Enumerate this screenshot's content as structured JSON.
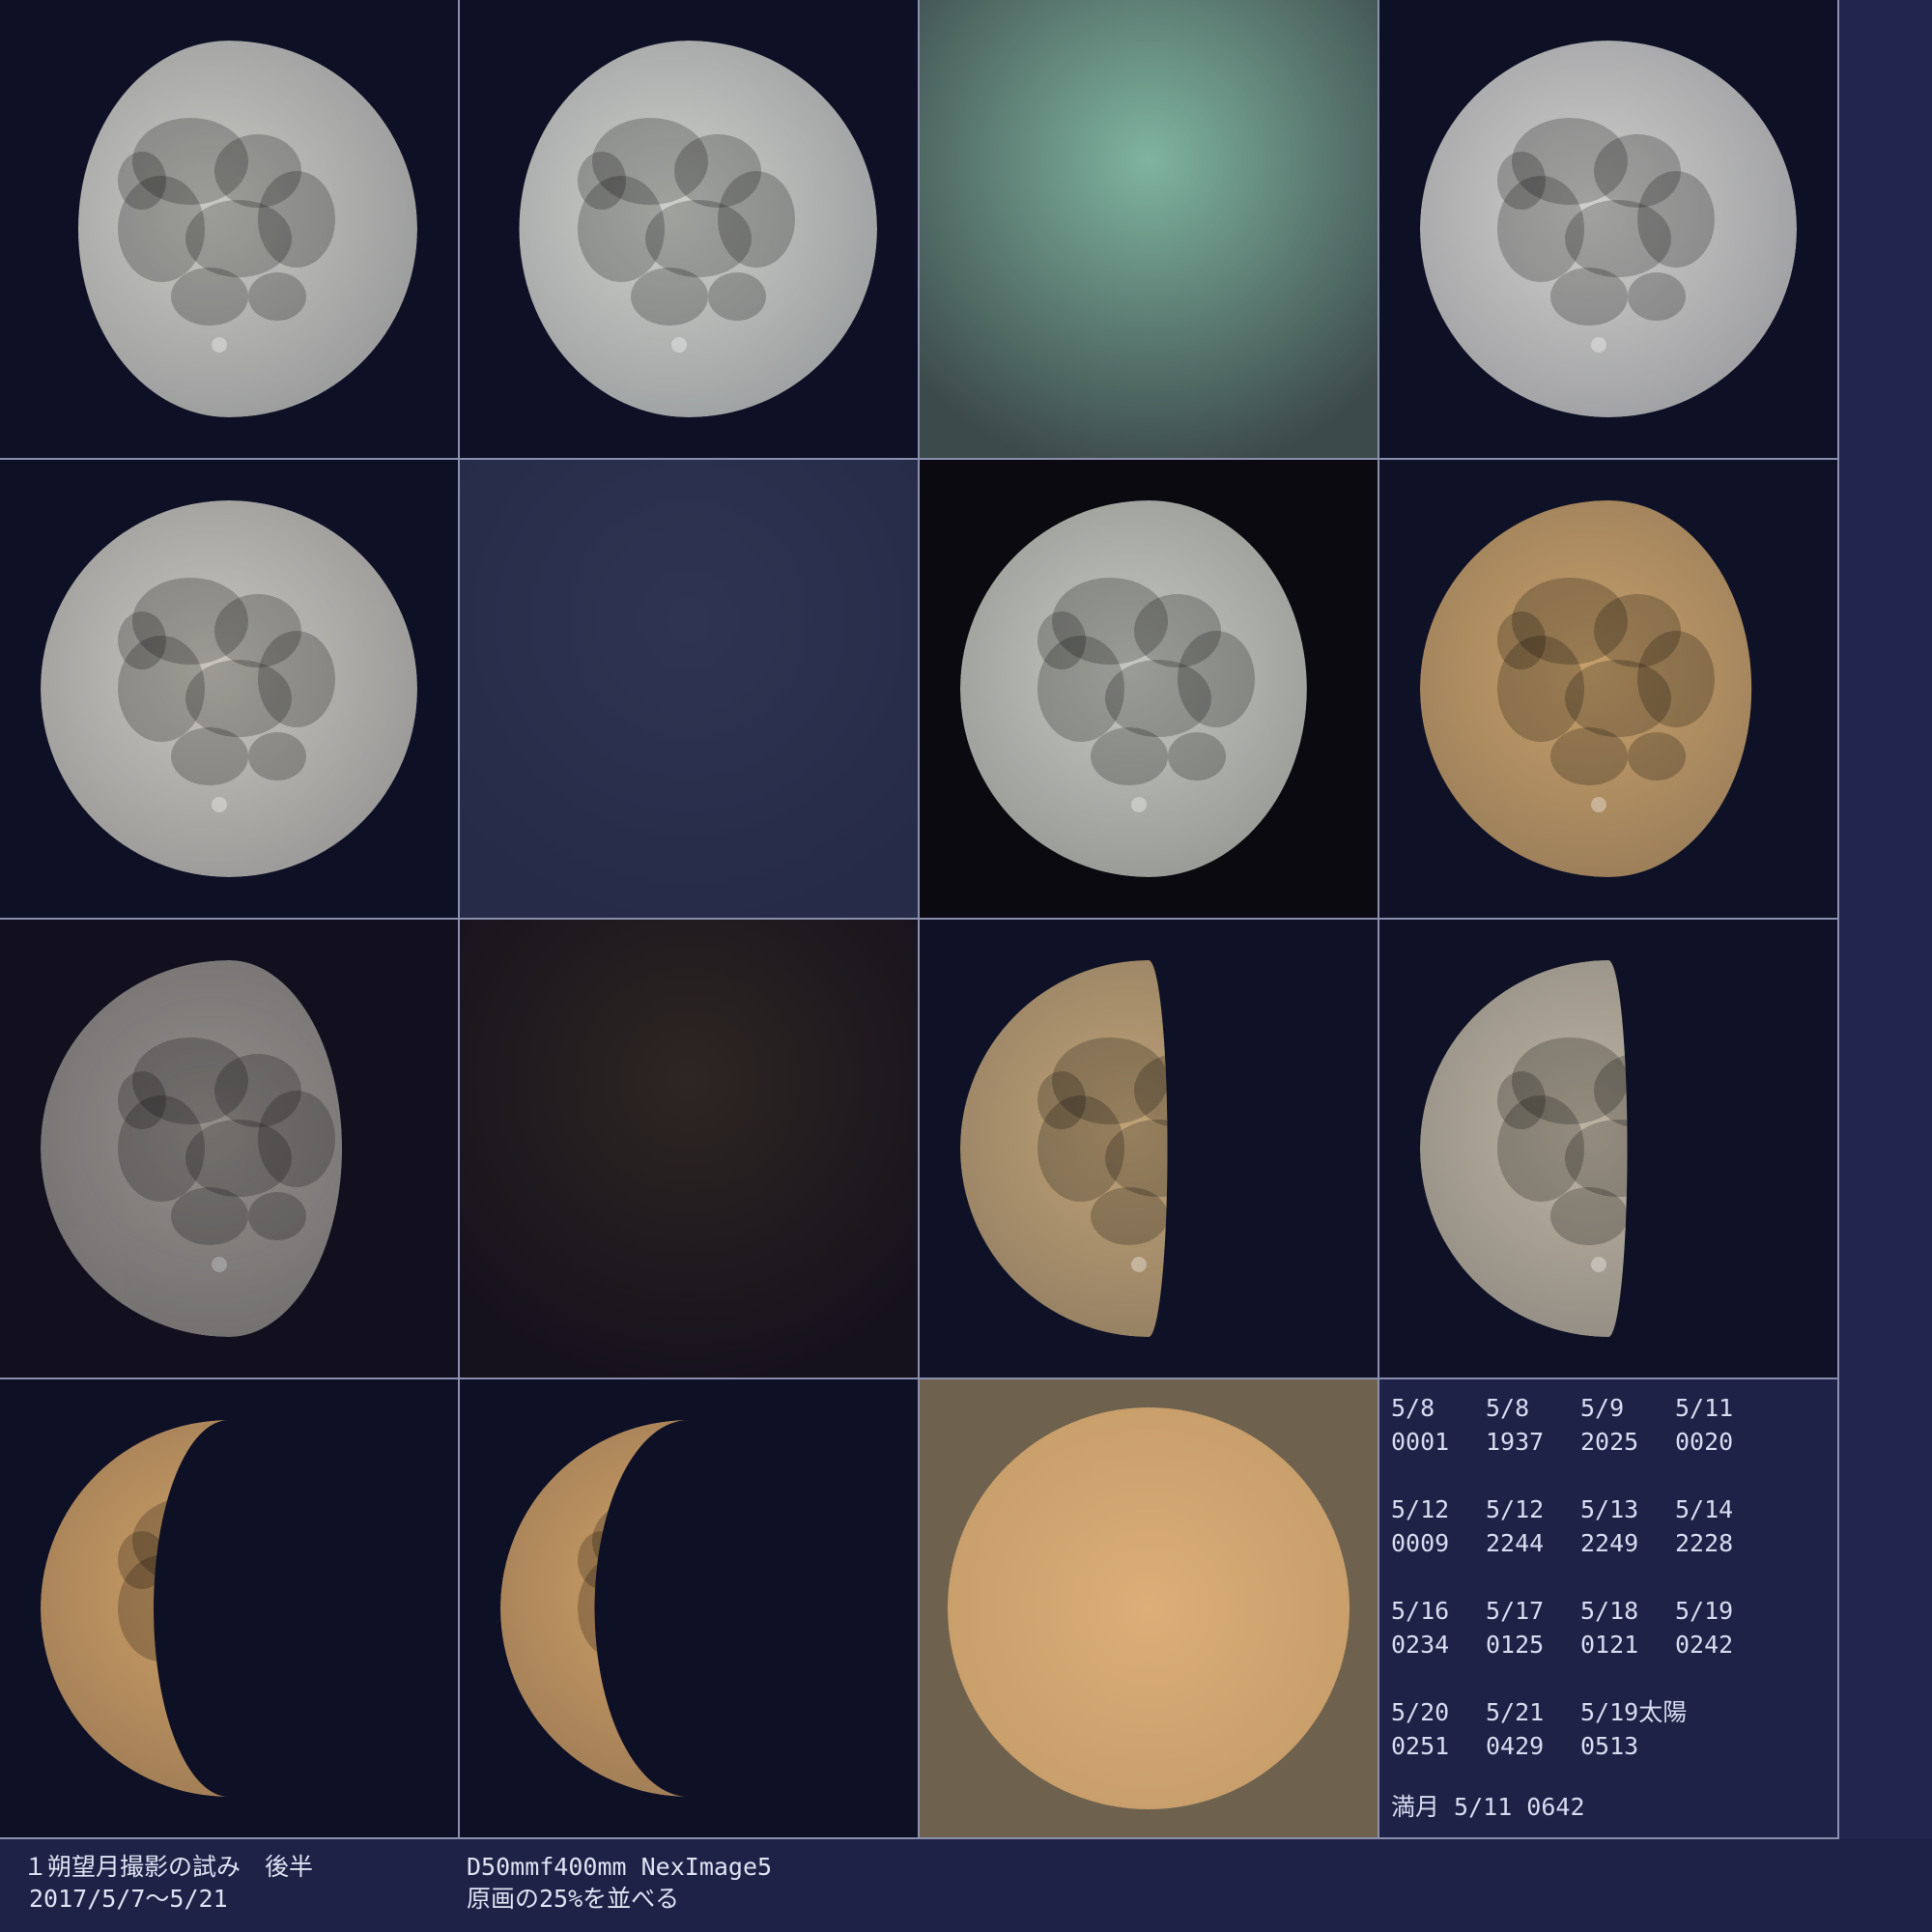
{
  "cells": [
    {
      "name": "moon-5-8-0001",
      "kind": "moon",
      "bg": "#0e1026",
      "tint": "#c9c9c3",
      "phase": 0.9,
      "dir": "right",
      "visible": 1.0
    },
    {
      "name": "moon-5-8-1937",
      "kind": "moon",
      "bg": "#0e1026",
      "tint": "#cdd0ca",
      "phase": 0.95,
      "dir": "right",
      "visible": 1.0
    },
    {
      "name": "sky-5-9-2025",
      "kind": "haze",
      "bg": "#3c4a4a",
      "tint": "#7fb4a0"
    },
    {
      "name": "moon-5-11-0020",
      "kind": "moon",
      "bg": "#0e1026",
      "tint": "#cfcfcc",
      "phase": 1.0,
      "dir": "right",
      "visible": 1.0
    },
    {
      "name": "moon-5-12-0009",
      "kind": "moon",
      "bg": "#0e1026",
      "tint": "#c8c6bd",
      "phase": 1.0,
      "dir": "left",
      "visible": 1.0
    },
    {
      "name": "sky-5-12-2244",
      "kind": "haze",
      "bg": "#262b47",
      "tint": "#2e3452"
    },
    {
      "name": "moon-5-13-2249",
      "kind": "moon",
      "bg": "#0b0a10",
      "tint": "#c5c8c0",
      "phase": 0.92,
      "dir": "left",
      "visible": 1.0
    },
    {
      "name": "moon-5-14-2228",
      "kind": "moon",
      "bg": "#0f1226",
      "tint": "#c7a06a",
      "phase": 0.88,
      "dir": "left",
      "visible": 1.0
    },
    {
      "name": "moon-5-16-0234",
      "kind": "moon",
      "bg": "#120f1e",
      "tint": "#a9a69e",
      "phase": 0.8,
      "dir": "left",
      "visible": 0.85
    },
    {
      "name": "sky-5-17-0125",
      "kind": "haze",
      "bg": "#15111d",
      "tint": "#2e2622"
    },
    {
      "name": "moon-5-18-0121",
      "kind": "moon",
      "bg": "#0f1226",
      "tint": "#c0a377",
      "phase": 0.55,
      "dir": "left",
      "visible": 1.0
    },
    {
      "name": "moon-5-19-0242",
      "kind": "moon",
      "bg": "#0f1226",
      "tint": "#bdb4a2",
      "phase": 0.55,
      "dir": "left",
      "visible": 1.0
    },
    {
      "name": "moon-5-20-0251",
      "kind": "moon",
      "bg": "#0e1026",
      "tint": "#cfa066",
      "phase": 0.3,
      "dir": "left",
      "visible": 1.0
    },
    {
      "name": "moon-5-21-0429",
      "kind": "moon",
      "bg": "#0e1026",
      "tint": "#cfa066",
      "phase": 0.25,
      "dir": "left",
      "visible": 1.0
    },
    {
      "name": "sun-5-19-0513",
      "kind": "sun",
      "bg": "#6e624e",
      "tint": "#d4a873"
    }
  ],
  "info": {
    "entries": [
      {
        "date": "5/8",
        "time": "0001"
      },
      {
        "date": "5/8",
        "time": "1937"
      },
      {
        "date": "5/9",
        "time": "2025"
      },
      {
        "date": "5/11",
        "time": "0020"
      },
      {
        "date": "5/12",
        "time": "0009"
      },
      {
        "date": "5/12",
        "time": "2244"
      },
      {
        "date": "5/13",
        "time": "2249"
      },
      {
        "date": "5/14",
        "time": "2228"
      },
      {
        "date": "5/16",
        "time": "0234"
      },
      {
        "date": "5/17",
        "time": "0125"
      },
      {
        "date": "5/18",
        "time": "0121"
      },
      {
        "date": "5/19",
        "time": "0242"
      },
      {
        "date": "5/20",
        "time": "0251"
      },
      {
        "date": "5/21",
        "time": "0429"
      },
      {
        "date": "5/19太陽",
        "time": "0513"
      }
    ],
    "full_moon": "満月 5/11 0642"
  },
  "captions": {
    "title": "１朔望月撮影の試み　後半",
    "date_range": "2017/5/7～5/21",
    "equipment": "D50mmf400mm NexImage5",
    "note": "原画の25%を並べる"
  }
}
